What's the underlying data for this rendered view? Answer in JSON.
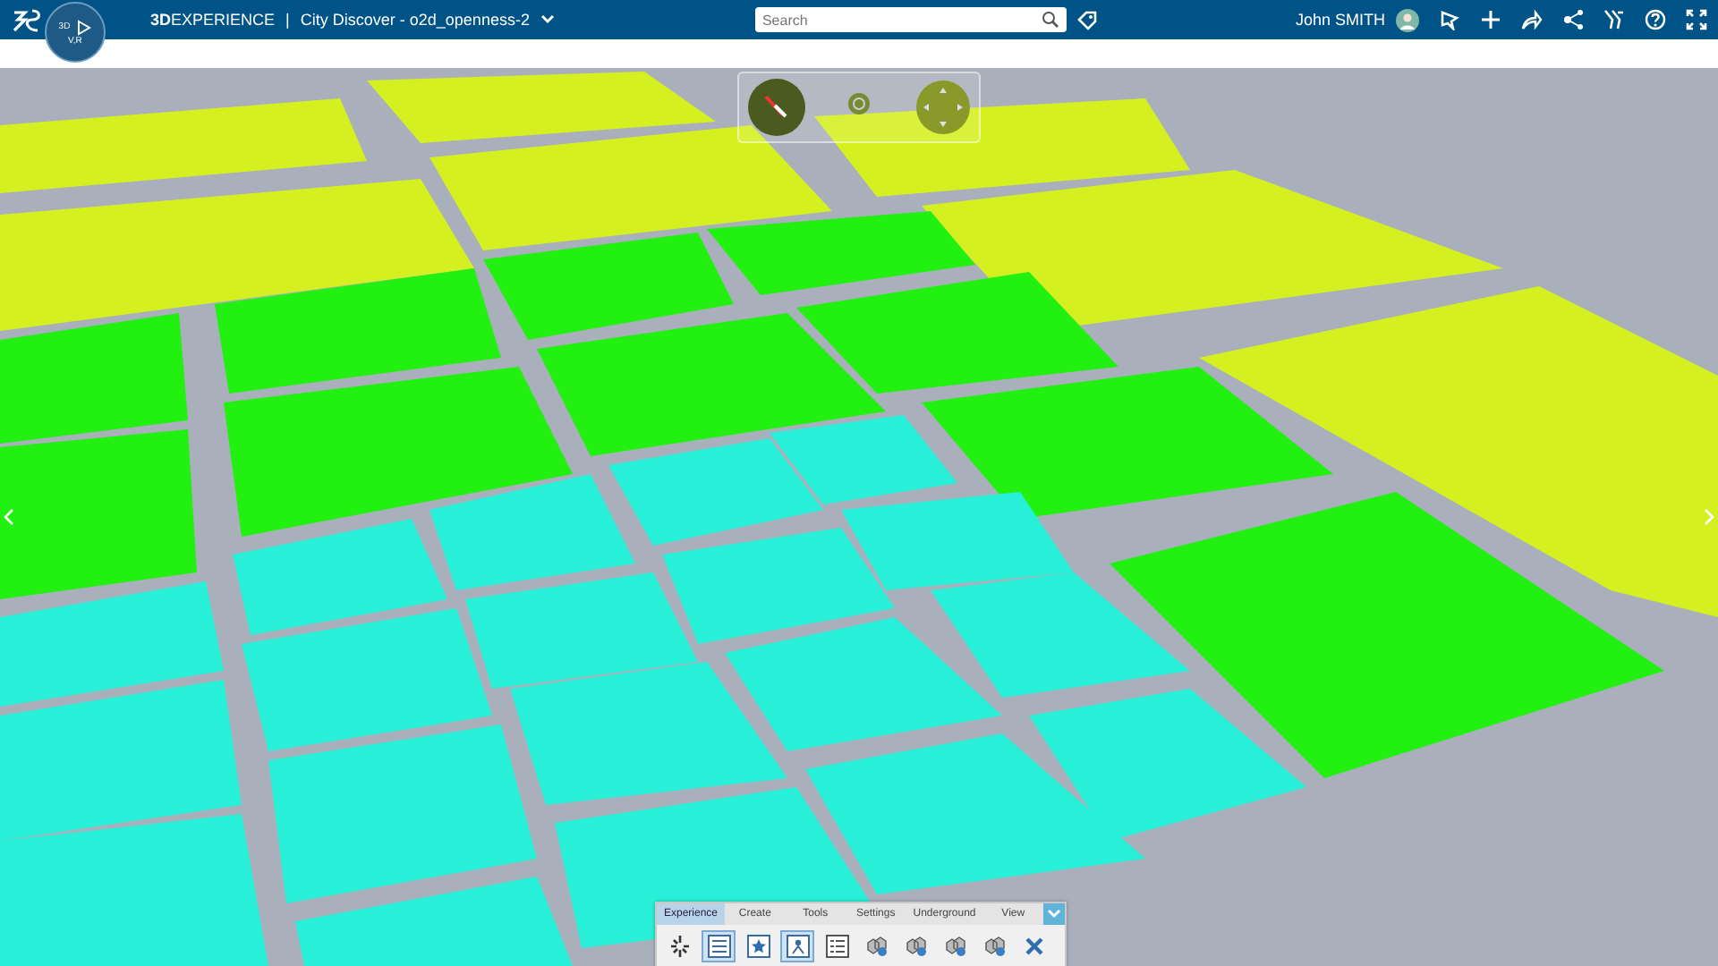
{
  "top_bar": {
    "brand_bold": "3D",
    "brand": "EXPERIENCE",
    "separator": "|",
    "app_title": "City Discover - o2d_openness-2",
    "search": {
      "placeholder": "Search"
    },
    "user_name": "John SMITH"
  },
  "compass": {
    "mode": "3D",
    "label": "V,R"
  },
  "toolbar": {
    "tabs": [
      {
        "label": "Experience",
        "selected": true
      },
      {
        "label": "Create",
        "selected": false
      },
      {
        "label": "Tools",
        "selected": false
      },
      {
        "label": "Settings",
        "selected": false
      },
      {
        "label": "Underground",
        "selected": false
      },
      {
        "label": "View",
        "selected": false
      }
    ],
    "tools": [
      {
        "kind": "spark",
        "selected": false
      },
      {
        "kind": "list",
        "selected": true
      },
      {
        "kind": "star",
        "selected": false
      },
      {
        "kind": "person",
        "selected": true
      },
      {
        "kind": "table",
        "selected": false
      },
      {
        "kind": "cubes",
        "selected": false
      },
      {
        "kind": "cubes",
        "selected": false
      },
      {
        "kind": "cubes",
        "selected": false
      },
      {
        "kind": "cubes",
        "selected": false
      },
      {
        "kind": "close",
        "selected": false
      }
    ]
  }
}
